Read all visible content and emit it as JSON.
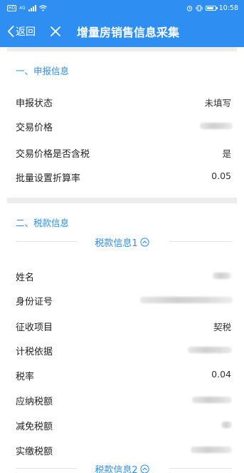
{
  "status_bar": {
    "hd_label": "HD",
    "network_label": "4G",
    "time": "10:58"
  },
  "nav": {
    "back_label": "返回",
    "title": "增量房销售信息采集"
  },
  "section1": {
    "title": "一、申报信息",
    "rows": [
      {
        "label": "申报状态",
        "value": "未填写"
      },
      {
        "label": "交易价格",
        "value": ""
      },
      {
        "label": "交易价格是否含税",
        "value": "是"
      },
      {
        "label": "批量设置折算率",
        "value": "0.05"
      }
    ]
  },
  "section2": {
    "title": "二、税款信息",
    "sub1": "税款信息1",
    "sub2": "税款信息2",
    "rows": [
      {
        "label": "姓名",
        "value": ""
      },
      {
        "label": "身份证号",
        "value": ""
      },
      {
        "label": "征收项目",
        "value": "契税"
      },
      {
        "label": "计税依据",
        "value": ""
      },
      {
        "label": "税率",
        "value": "0.04"
      },
      {
        "label": "应纳税额",
        "value": ""
      },
      {
        "label": "减免税额",
        "value": ""
      },
      {
        "label": "实缴税额",
        "value": ""
      }
    ]
  },
  "colors": {
    "accent": "#2f8ef2",
    "band": "#ededed"
  }
}
